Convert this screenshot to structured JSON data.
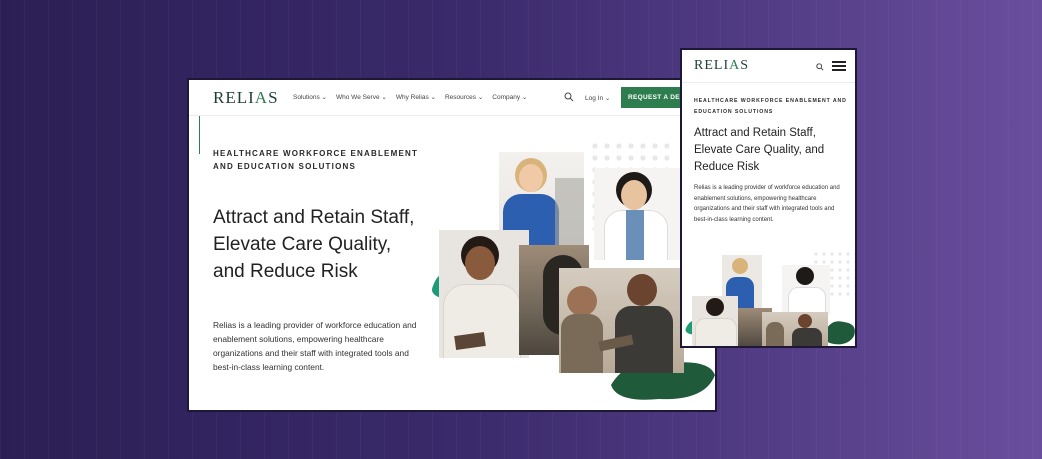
{
  "desktop": {
    "logo": {
      "pre": "RELI",
      "accent": "A",
      "post": "S"
    },
    "nav": [
      {
        "label": "Solutions ⌄"
      },
      {
        "label": "Who We Serve ⌄"
      },
      {
        "label": "Why Relias ⌄"
      },
      {
        "label": "Resources ⌄"
      },
      {
        "label": "Company ⌄"
      }
    ],
    "login": "Log In ⌄",
    "cta": "REQUEST A DEMO",
    "eyebrow": "HEALTHCARE WORKFORCE ENABLEMENT AND EDUCATION SOLUTIONS",
    "title": "Attract and Retain Staff, Elevate Care Quality, and Reduce Risk",
    "body": "Relias is a leading provider of workforce education and enablement solutions, empowering healthcare organizations and their staff with integrated tools and best-in-class learning content."
  },
  "mobile": {
    "logo": {
      "pre": "RELI",
      "accent": "A",
      "post": "S"
    },
    "eyebrow": "HEALTHCARE WORKFORCE ENABLEMENT AND EDUCATION SOLUTIONS",
    "title": "Attract and Retain Staff, Elevate Care Quality, and Reduce Risk",
    "body": "Relias is a leading provider of workforce education and enablement solutions, empowering healthcare organizations and their staff with integrated tools and best-in-class learning content."
  },
  "colors": {
    "brand_green": "#2e7d4f",
    "dark_green": "#1f5a3a",
    "teal": "#1e9a78",
    "background_start": "#2b1f55",
    "background_end": "#6a4e9e"
  },
  "icons": [
    "search-icon",
    "menu-icon"
  ]
}
